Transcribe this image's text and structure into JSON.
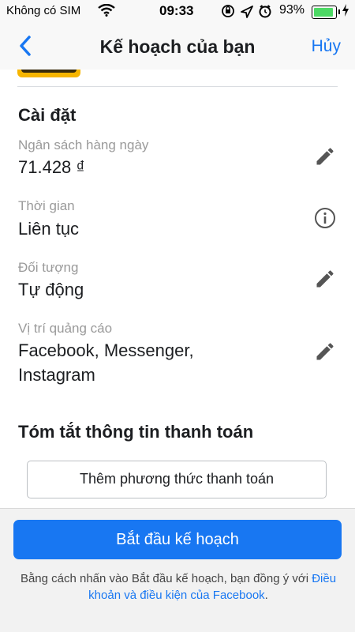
{
  "status_bar": {
    "carrier": "Không có SIM",
    "time": "09:33",
    "battery": "93%"
  },
  "nav": {
    "title": "Kế hoạch của bạn",
    "cancel": "Hủy"
  },
  "settings": {
    "title": "Cài đặt",
    "budget_label": "Ngân sách hàng ngày",
    "budget_value": "71.428 ₫",
    "duration_label": "Thời gian",
    "duration_value": "Liên tục",
    "audience_label": "Đối tượng",
    "audience_value": "Tự động",
    "placement_label": "Vị trí quảng cáo",
    "placement_value_line1": "Facebook, Messenger,",
    "placement_value_line2": "Instagram"
  },
  "payment": {
    "title": "Tóm tắt thông tin thanh toán",
    "add_method": "Thêm phương thức thanh toán"
  },
  "footer": {
    "start_button": "Bắt đầu kế hoạch",
    "terms_prefix": "Bằng cách nhấn vào Bắt đầu kế hoạch, bạn đồng ý với ",
    "terms_link": "Điều khoản và điều kiện của Facebook",
    "terms_suffix": "."
  },
  "colors": {
    "accent": "#1877f2",
    "battery": "#4cd964"
  },
  "icons": [
    "wifi-icon",
    "back-chevron-icon",
    "edit-pencil-icon",
    "info-icon",
    "location-arrow-icon",
    "alarm-icon",
    "rotation-lock-icon",
    "charging-bolt-icon"
  ]
}
